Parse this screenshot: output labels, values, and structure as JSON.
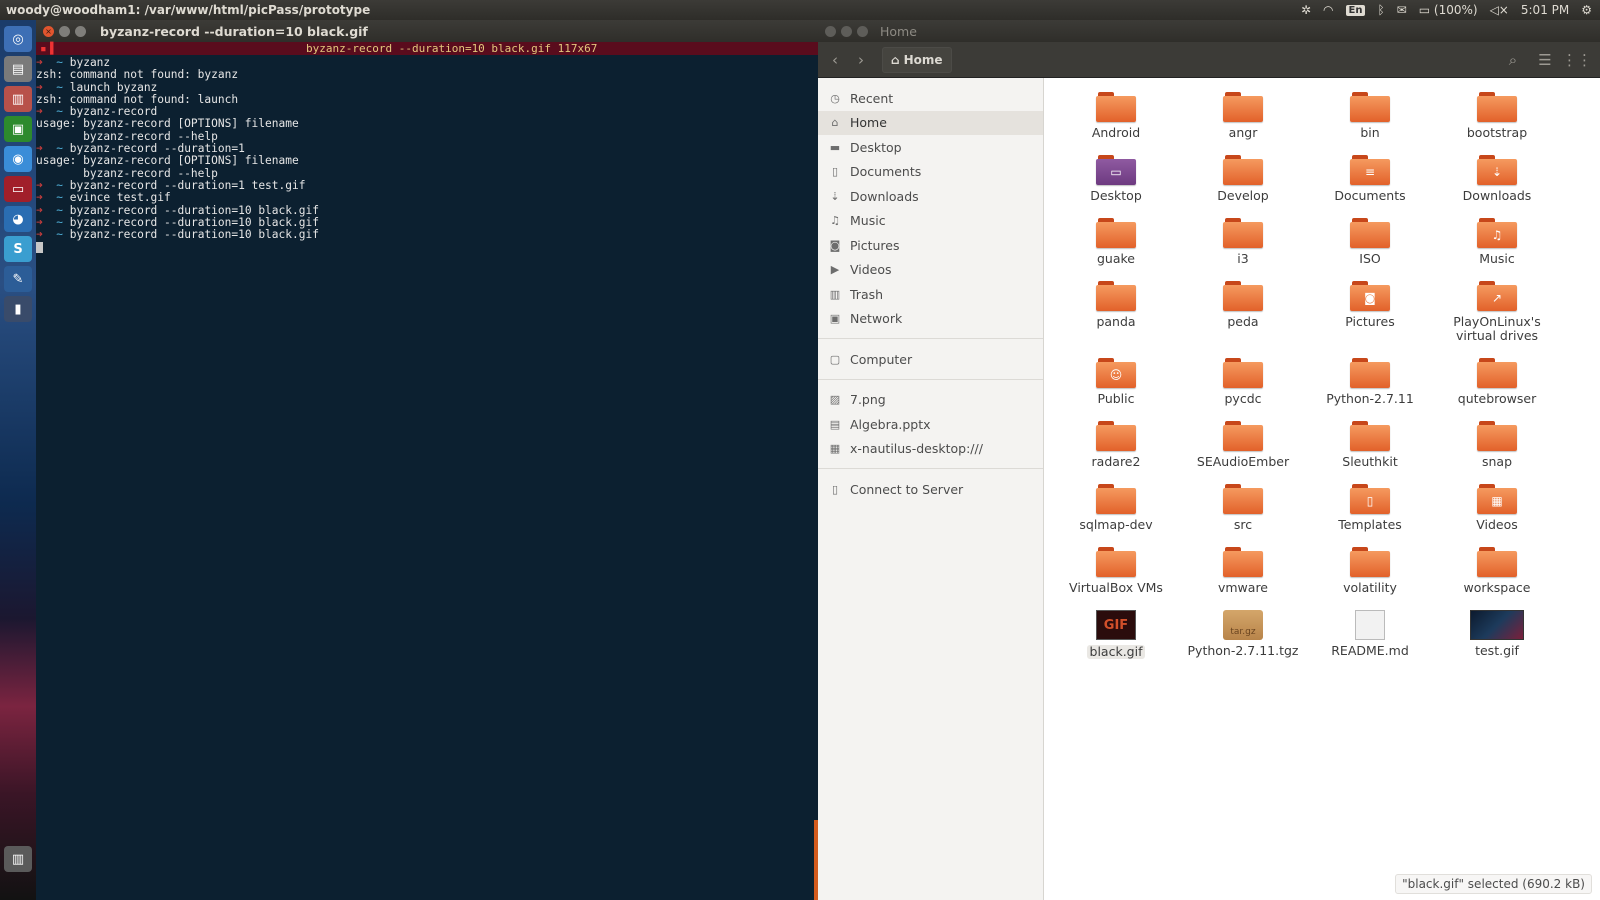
{
  "top_panel": {
    "title": "woody@woodham1: /var/www/html/picPass/prototype",
    "lang": "En",
    "battery": "(100%)",
    "clock": "5:01 PM"
  },
  "terminal": {
    "window_title": "byzanz-record --duration=10 black.gif",
    "tmux_status": "byzanz-record --duration=10 black.gif 117x67",
    "lines": [
      {
        "prompt": true,
        "cmd": "byzanz"
      },
      {
        "prompt": false,
        "text": "zsh: command not found: byzanz"
      },
      {
        "prompt": true,
        "cmd": "launch byzanz"
      },
      {
        "prompt": false,
        "text": "zsh: command not found: launch"
      },
      {
        "prompt": true,
        "cmd": "byzanz-record"
      },
      {
        "prompt": false,
        "text": "usage: byzanz-record [OPTIONS] filename"
      },
      {
        "prompt": false,
        "text": "       byzanz-record --help"
      },
      {
        "prompt": true,
        "cmd": "byzanz-record --duration=1"
      },
      {
        "prompt": false,
        "text": "usage: byzanz-record [OPTIONS] filename"
      },
      {
        "prompt": false,
        "text": "       byzanz-record --help"
      },
      {
        "prompt": true,
        "cmd": "byzanz-record --duration=1 test.gif"
      },
      {
        "prompt": true,
        "cmd": "evince test.gif"
      },
      {
        "prompt": true,
        "cmd": "byzanz-record --duration=10 black.gif"
      },
      {
        "prompt": true,
        "cmd": "byzanz-record --duration=10 black.gif"
      },
      {
        "prompt": true,
        "cmd": "byzanz-record --duration=10 black.gif"
      }
    ],
    "prompt_arrow": "➜",
    "prompt_tilde": "~"
  },
  "files": {
    "window_title": "Home",
    "path_label": "Home",
    "sidebar": [
      {
        "label": "Recent",
        "icon": "clock-icon",
        "glyph": "◷"
      },
      {
        "label": "Home",
        "icon": "home-icon",
        "glyph": "⌂",
        "active": true
      },
      {
        "label": "Desktop",
        "icon": "folder-icon",
        "glyph": "▬"
      },
      {
        "label": "Documents",
        "icon": "document-icon",
        "glyph": "▯"
      },
      {
        "label": "Downloads",
        "icon": "download-icon",
        "glyph": "⇣"
      },
      {
        "label": "Music",
        "icon": "music-icon",
        "glyph": "♫"
      },
      {
        "label": "Pictures",
        "icon": "camera-icon",
        "glyph": "◙"
      },
      {
        "label": "Videos",
        "icon": "video-icon",
        "glyph": "▶"
      },
      {
        "label": "Trash",
        "icon": "trash-icon",
        "glyph": "▥"
      },
      {
        "label": "Network",
        "icon": "network-icon",
        "glyph": "▣"
      },
      {
        "sep": true
      },
      {
        "label": "Computer",
        "icon": "computer-icon",
        "glyph": "▢"
      },
      {
        "sep": true
      },
      {
        "label": "7.png",
        "icon": "image-icon",
        "glyph": "▨"
      },
      {
        "label": "Algebra.pptx",
        "icon": "presentation-icon",
        "glyph": "▤"
      },
      {
        "label": "x-nautilus-desktop:///",
        "icon": "desktop-icon",
        "glyph": "▦"
      },
      {
        "sep": true
      },
      {
        "label": "Connect to Server",
        "icon": "server-icon",
        "glyph": "▯"
      }
    ],
    "items": [
      [
        "Android",
        "angr",
        "bin",
        "bootstrap"
      ],
      [
        "Desktop",
        "Develop",
        "Documents",
        "Downloads"
      ],
      [
        "guake",
        "i3",
        "ISO",
        "Music"
      ],
      [
        "panda",
        "peda",
        "Pictures",
        "PlayOnLinux's virtual drives"
      ],
      [
        "Public",
        "pycdc",
        "Python-2.7.11",
        "qutebrowser"
      ],
      [
        "radare2",
        "SEAudioEmber",
        "Sleuthkit",
        "snap"
      ],
      [
        "sqlmap-dev",
        "src",
        "Templates",
        "Videos"
      ],
      [
        "VirtualBox VMs",
        "vmware",
        "volatility",
        "workspace"
      ],
      [
        "black.gif",
        "Python-2.7.11.tgz",
        "README.md",
        "test.gif"
      ]
    ],
    "thumb_gif": "GIF",
    "thumb_tgz": "tar.gz",
    "status": "\"black.gif\" selected (690.2 kB)"
  }
}
